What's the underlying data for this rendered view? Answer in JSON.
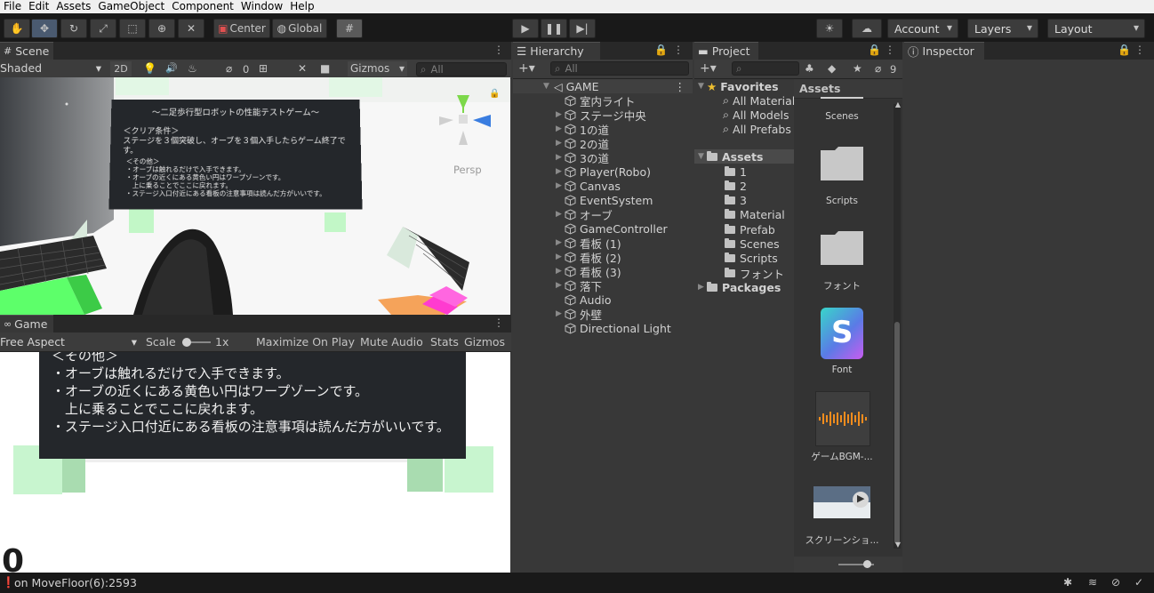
{
  "menu": [
    "File",
    "Edit",
    "Assets",
    "GameObject",
    "Component",
    "Window",
    "Help"
  ],
  "toolbar": {
    "center_label": "Center",
    "global_label": "Global",
    "account_label": "Account",
    "layers_label": "Layers",
    "layout_label": "Layout"
  },
  "scene": {
    "tab_label": "Scene",
    "shading_label": "Shaded",
    "mode_2d_label": "2D",
    "hidden_count": "0",
    "gizmos_label": "Gizmos",
    "search_placeholder": "All",
    "persp_label": "Persp",
    "sign_title": "〜二足歩行型ロボットの性能テストゲーム〜",
    "sign_clear_header": "＜クリア条件＞",
    "sign_clear_text": "ステージを３個突破し、オーブを３個入手したらゲーム終了です。",
    "sign_other_header": "＜その他＞",
    "sign_lines": [
      "・オーブは触れるだけで入手できます。",
      "・オーブの近くにある黄色い円はワープゾーンです。",
      "　上に乗ることでここに戻れます。",
      "・ステージ入口付近にある看板の注意事項は読んだ方がいいです。"
    ]
  },
  "game": {
    "tab_label": "Game",
    "aspect_label": "Free Aspect",
    "scale_label": "Scale",
    "scale_value": "1x",
    "maximize_label": "Maximize On Play",
    "mute_label": "Mute Audio",
    "stats_label": "Stats",
    "gizmos_label": "Gizmos",
    "sign_header": "＜その他＞",
    "sign_lines": [
      "・オーブは触れるだけで入手できます。",
      "・オーブの近くにある黄色い円はワープゾーンです。",
      "　上に乗ることでここに戻れます。",
      "・ステージ入口付近にある看板の注意事項は読んだ方がいいです。"
    ],
    "score_text": "0"
  },
  "hierarchy": {
    "tab_label": "Hierarchy",
    "search_placeholder": "All",
    "root_label": "GAME",
    "items": [
      {
        "label": "室内ライト",
        "expandable": false
      },
      {
        "label": "ステージ中央",
        "expandable": true
      },
      {
        "label": "1の道",
        "expandable": true
      },
      {
        "label": "2の道",
        "expandable": true
      },
      {
        "label": "3の道",
        "expandable": true
      },
      {
        "label": "Player(Robo)",
        "expandable": true
      },
      {
        "label": "Canvas",
        "expandable": true
      },
      {
        "label": "EventSystem",
        "expandable": false
      },
      {
        "label": "オーブ",
        "expandable": true
      },
      {
        "label": "GameController",
        "expandable": false
      },
      {
        "label": "看板 (1)",
        "expandable": true
      },
      {
        "label": "看板 (2)",
        "expandable": true
      },
      {
        "label": "看板 (3)",
        "expandable": true
      },
      {
        "label": "落下",
        "expandable": true
      },
      {
        "label": "Audio",
        "expandable": false
      },
      {
        "label": "外壁",
        "expandable": true
      },
      {
        "label": "Directional Light",
        "expandable": false
      }
    ]
  },
  "project": {
    "tab_label": "Project",
    "hidden_count": "9",
    "favorites_label": "Favorites",
    "favorites": [
      "All Materials",
      "All Models",
      "All Prefabs"
    ],
    "assets_label": "Assets",
    "asset_folders": [
      "1",
      "2",
      "3",
      "Material",
      "Prefab",
      "Scenes",
      "Scripts",
      "フォント"
    ],
    "packages_label": "Packages",
    "grid_header": "Assets",
    "grid_items": [
      "Scenes",
      "Scripts",
      "フォント",
      "Font",
      "ゲームBGM-...",
      "スクリーンショ..."
    ]
  },
  "inspector": {
    "tab_label": "Inspector"
  },
  "status": {
    "message": "on MoveFloor(6):2593"
  },
  "colors": {
    "accent_blue": "#4a6a9a",
    "scene_green": "#5dff6a",
    "scene_orange": "#f5a35a",
    "scene_magenta": "#ff3bd0",
    "font_asset_purple": "#7a4ad8"
  }
}
